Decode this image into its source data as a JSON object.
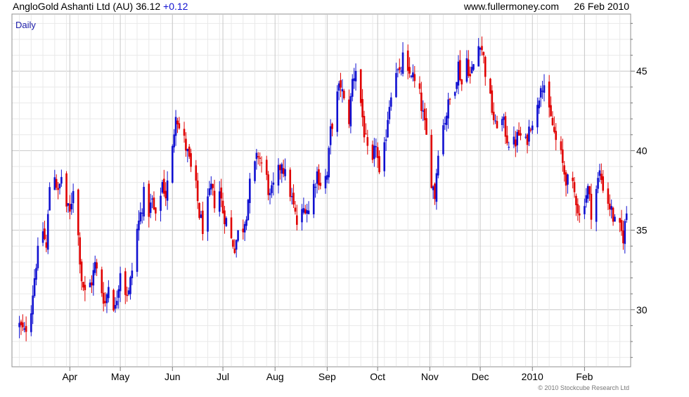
{
  "header": {
    "ticker_name": "AngloGold Ashanti Ltd (AU)",
    "price": "36.12",
    "change": "+0.12",
    "website": "www.fullermoney.com",
    "date": "26 Feb 2010"
  },
  "chart_label": "Daily",
  "footer": {
    "copyright": "© 2010 Stockcube Research Ltd"
  },
  "colors": {
    "up": "#1010d0",
    "down": "#e00000",
    "grid_major": "#c8c8c8",
    "grid_minor": "#e9e9e9",
    "change": "#1010d0",
    "label": "#1a1aa8"
  },
  "chart_data": {
    "type": "candlestick",
    "ylim": [
      26.5,
      48.5
    ],
    "y_ticks": [
      30,
      35,
      40,
      45
    ],
    "x_range": [
      "2010-03-12",
      "2010-02-28"
    ],
    "x_ticks": [
      {
        "label": "Apr",
        "date": "2009-04-01"
      },
      {
        "label": "May",
        "date": "2009-05-01"
      },
      {
        "label": "Jun",
        "date": "2009-06-01"
      },
      {
        "label": "Jul",
        "date": "2009-07-01"
      },
      {
        "label": "Aug",
        "date": "2009-08-01"
      },
      {
        "label": "Sep",
        "date": "2009-09-01"
      },
      {
        "label": "Oct",
        "date": "2009-10-01"
      },
      {
        "label": "Nov",
        "date": "2009-11-01"
      },
      {
        "label": "Dec",
        "date": "2009-12-01"
      },
      {
        "label": "2010",
        "date": "2010-01-01"
      },
      {
        "label": "Feb",
        "date": "2010-02-01"
      }
    ],
    "grid": true,
    "close_path": [
      [
        "2009-03-02",
        29.0
      ],
      [
        "2009-03-05",
        28.5
      ],
      [
        "2009-03-09",
        30.2
      ],
      [
        "2009-03-12",
        33.0
      ],
      [
        "2009-03-16",
        35.0
      ],
      [
        "2009-03-18",
        33.8
      ],
      [
        "2009-03-20",
        37.8
      ],
      [
        "2009-03-23",
        38.6
      ],
      [
        "2009-03-25",
        37.2
      ],
      [
        "2009-03-27",
        38.4
      ],
      [
        "2009-03-30",
        36.5
      ],
      [
        "2009-04-01",
        36.0
      ],
      [
        "2009-04-03",
        37.8
      ],
      [
        "2009-04-06",
        34.6
      ],
      [
        "2009-04-08",
        32.0
      ],
      [
        "2009-04-10",
        31.0
      ],
      [
        "2009-04-14",
        31.8
      ],
      [
        "2009-04-16",
        32.8
      ],
      [
        "2009-04-20",
        31.2
      ],
      [
        "2009-04-22",
        30.4
      ],
      [
        "2009-04-24",
        31.6
      ],
      [
        "2009-04-28",
        30.0
      ],
      [
        "2009-05-01",
        32.6
      ],
      [
        "2009-05-04",
        31.2
      ],
      [
        "2009-05-06",
        31.0
      ],
      [
        "2009-05-08",
        32.5
      ],
      [
        "2009-05-11",
        35.0
      ],
      [
        "2009-05-13",
        36.0
      ],
      [
        "2009-05-15",
        37.2
      ],
      [
        "2009-05-18",
        36.2
      ],
      [
        "2009-05-20",
        36.8
      ],
      [
        "2009-05-22",
        35.6
      ],
      [
        "2009-05-26",
        38.0
      ],
      [
        "2009-05-28",
        37.2
      ],
      [
        "2009-06-01",
        40.0
      ],
      [
        "2009-06-03",
        42.6
      ],
      [
        "2009-06-05",
        41.4
      ],
      [
        "2009-06-08",
        40.6
      ],
      [
        "2009-06-10",
        39.8
      ],
      [
        "2009-06-12",
        38.8
      ],
      [
        "2009-06-15",
        37.6
      ],
      [
        "2009-06-17",
        36.0
      ],
      [
        "2009-06-19",
        35.2
      ],
      [
        "2009-06-22",
        36.6
      ],
      [
        "2009-06-24",
        37.6
      ],
      [
        "2009-06-26",
        36.8
      ],
      [
        "2009-06-29",
        37.5
      ],
      [
        "2009-07-01",
        36.2
      ],
      [
        "2009-07-03",
        35.6
      ],
      [
        "2009-07-06",
        34.4
      ],
      [
        "2009-07-08",
        34.0
      ],
      [
        "2009-07-10",
        34.8
      ],
      [
        "2009-07-13",
        35.2
      ],
      [
        "2009-07-15",
        36.2
      ],
      [
        "2009-07-17",
        37.8
      ],
      [
        "2009-07-20",
        39.0
      ],
      [
        "2009-07-22",
        39.8
      ],
      [
        "2009-07-24",
        39.2
      ],
      [
        "2009-07-27",
        38.2
      ],
      [
        "2009-07-29",
        37.0
      ],
      [
        "2009-08-03",
        38.6
      ],
      [
        "2009-08-05",
        39.4
      ],
      [
        "2009-08-07",
        38.4
      ],
      [
        "2009-08-10",
        37.4
      ],
      [
        "2009-08-12",
        36.4
      ],
      [
        "2009-08-14",
        35.4
      ],
      [
        "2009-08-17",
        36.0
      ],
      [
        "2009-08-19",
        36.6
      ],
      [
        "2009-08-21",
        36.2
      ],
      [
        "2009-08-24",
        37.8
      ],
      [
        "2009-08-26",
        38.6
      ],
      [
        "2009-08-28",
        38.0
      ],
      [
        "2009-09-01",
        38.4
      ],
      [
        "2009-09-03",
        41.2
      ],
      [
        "2009-09-07",
        43.4
      ],
      [
        "2009-09-09",
        44.2
      ],
      [
        "2009-09-11",
        43.0
      ],
      [
        "2009-09-14",
        42.0
      ],
      [
        "2009-09-16",
        44.4
      ],
      [
        "2009-09-18",
        45.2
      ],
      [
        "2009-09-21",
        43.0
      ],
      [
        "2009-09-23",
        41.2
      ],
      [
        "2009-09-25",
        39.8
      ],
      [
        "2009-09-28",
        39.0
      ],
      [
        "2009-09-30",
        40.6
      ],
      [
        "2009-10-02",
        38.2
      ],
      [
        "2009-10-05",
        40.0
      ],
      [
        "2009-10-07",
        42.2
      ],
      [
        "2009-10-09",
        43.8
      ],
      [
        "2009-10-12",
        45.2
      ],
      [
        "2009-10-14",
        44.6
      ],
      [
        "2009-10-16",
        45.8
      ],
      [
        "2009-10-19",
        44.6
      ],
      [
        "2009-10-21",
        45.0
      ],
      [
        "2009-10-23",
        44.2
      ],
      [
        "2009-10-26",
        43.4
      ],
      [
        "2009-10-28",
        42.2
      ],
      [
        "2009-10-30",
        40.8
      ],
      [
        "2009-11-02",
        38.2
      ],
      [
        "2009-11-04",
        37.2
      ],
      [
        "2009-11-06",
        40.2
      ],
      [
        "2009-11-09",
        41.6
      ],
      [
        "2009-11-11",
        42.4
      ],
      [
        "2009-11-13",
        43.2
      ],
      [
        "2009-11-16",
        44.2
      ],
      [
        "2009-11-18",
        45.4
      ],
      [
        "2009-11-20",
        44.2
      ],
      [
        "2009-11-23",
        45.8
      ],
      [
        "2009-11-25",
        44.6
      ],
      [
        "2009-11-27",
        45.4
      ],
      [
        "2009-12-01",
        47.0
      ],
      [
        "2009-12-03",
        45.8
      ],
      [
        "2009-12-05",
        44.2
      ],
      [
        "2009-12-08",
        42.6
      ],
      [
        "2009-12-10",
        41.4
      ],
      [
        "2009-12-12",
        42.2
      ],
      [
        "2009-12-15",
        41.6
      ],
      [
        "2009-12-17",
        40.8
      ],
      [
        "2009-12-20",
        40.2
      ],
      [
        "2009-12-22",
        40.6
      ],
      [
        "2009-12-24",
        41.0
      ],
      [
        "2009-12-28",
        40.4
      ],
      [
        "2009-12-31",
        41.8
      ],
      [
        "2010-01-04",
        42.6
      ],
      [
        "2010-01-06",
        44.4
      ],
      [
        "2010-01-08",
        44.2
      ],
      [
        "2010-01-11",
        42.2
      ],
      [
        "2010-01-13",
        41.6
      ],
      [
        "2010-01-15",
        40.6
      ],
      [
        "2010-01-18",
        39.6
      ],
      [
        "2010-01-20",
        38.6
      ],
      [
        "2010-01-22",
        38.0
      ],
      [
        "2010-01-25",
        37.6
      ],
      [
        "2010-01-27",
        37.0
      ],
      [
        "2010-01-29",
        35.8
      ],
      [
        "2010-02-01",
        37.0
      ],
      [
        "2010-02-03",
        37.6
      ],
      [
        "2010-02-05",
        36.2
      ],
      [
        "2010-02-08",
        37.6
      ],
      [
        "2010-02-10",
        38.6
      ],
      [
        "2010-02-12",
        37.8
      ],
      [
        "2010-02-15",
        36.8
      ],
      [
        "2010-02-17",
        36.2
      ],
      [
        "2010-02-19",
        35.4
      ],
      [
        "2010-02-22",
        35.0
      ],
      [
        "2010-02-24",
        34.6
      ],
      [
        "2010-02-26",
        36.1
      ]
    ]
  }
}
